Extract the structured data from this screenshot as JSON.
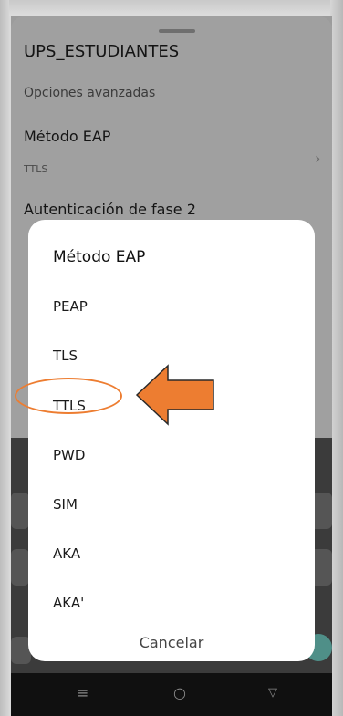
{
  "background": {
    "network_title": "UPS_ESTUDIANTES",
    "section_header": "Opciones avanzadas",
    "eap_label": "Método EAP",
    "eap_value": "TTLS",
    "phase2_label": "Autenticación de fase 2"
  },
  "dialog": {
    "title": "Método EAP",
    "options": [
      "PEAP",
      "TLS",
      "TTLS",
      "PWD",
      "SIM",
      "AKA",
      "AKA'"
    ],
    "cancel_label": "Cancelar",
    "highlighted_option": "TTLS"
  },
  "navbar": {
    "icons": [
      "menu-icon",
      "home-circle-icon",
      "back-triangle-icon"
    ]
  },
  "colors": {
    "annotation": "#ed7d31",
    "dialog_bg": "#ffffff",
    "scrim": "#9c9c9c"
  }
}
